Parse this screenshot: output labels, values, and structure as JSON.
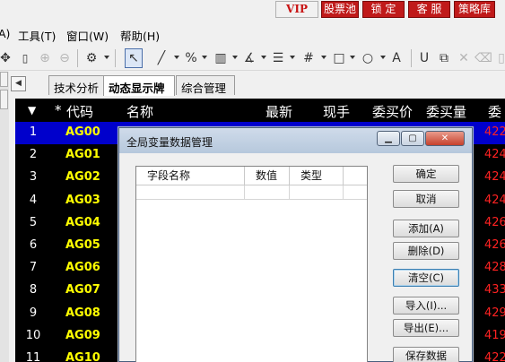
{
  "top_buttons": [
    {
      "label": "VIP"
    },
    {
      "label": "股票池"
    },
    {
      "label": "锁 定"
    },
    {
      "label": "客 服"
    },
    {
      "label": "策略库"
    }
  ],
  "menu": [
    "A)",
    "工具(T)",
    "窗口(W)",
    "帮助(H)"
  ],
  "tabs": [
    {
      "label": "技术分析"
    },
    {
      "label": "动态显示牌",
      "active": true
    },
    {
      "label": "综合管理"
    }
  ],
  "grid": {
    "headers": [
      "▼",
      "*",
      "代码",
      "名称",
      "最新",
      "现手",
      "委买价",
      "委买量",
      "委"
    ],
    "rows": [
      {
        "n": "1",
        "code": "AG00",
        "v": "422"
      },
      {
        "n": "2",
        "code": "AG01",
        "v": "424"
      },
      {
        "n": "3",
        "code": "AG02",
        "v": "424"
      },
      {
        "n": "4",
        "code": "AG03",
        "v": "424"
      },
      {
        "n": "5",
        "code": "AG04",
        "v": "426"
      },
      {
        "n": "6",
        "code": "AG05",
        "v": "426"
      },
      {
        "n": "7",
        "code": "AG06",
        "v": "428"
      },
      {
        "n": "8",
        "code": "AG07",
        "v": "433"
      },
      {
        "n": "9",
        "code": "AG08",
        "v": "429"
      },
      {
        "n": "10",
        "code": "AG09",
        "v": "419"
      },
      {
        "n": "11",
        "code": "AG10",
        "v": "422"
      }
    ],
    "selected_row_color": "#0000cc",
    "code_color": "#ffff00",
    "value_color": "#ff2222"
  },
  "dialog": {
    "title": "全局变量数据管理",
    "columns": [
      "字段名称",
      "数值",
      "类型"
    ],
    "buttons": {
      "ok": "确定",
      "cancel": "取消",
      "add": "添加(A)",
      "delete": "删除(D)",
      "clear": "清空(C)",
      "import": "导入(I)...",
      "export": "导出(E)...",
      "save": "保存数据"
    }
  },
  "colors": {
    "vip_text": "#c81414",
    "top_button_bg": "#c01a1a"
  }
}
